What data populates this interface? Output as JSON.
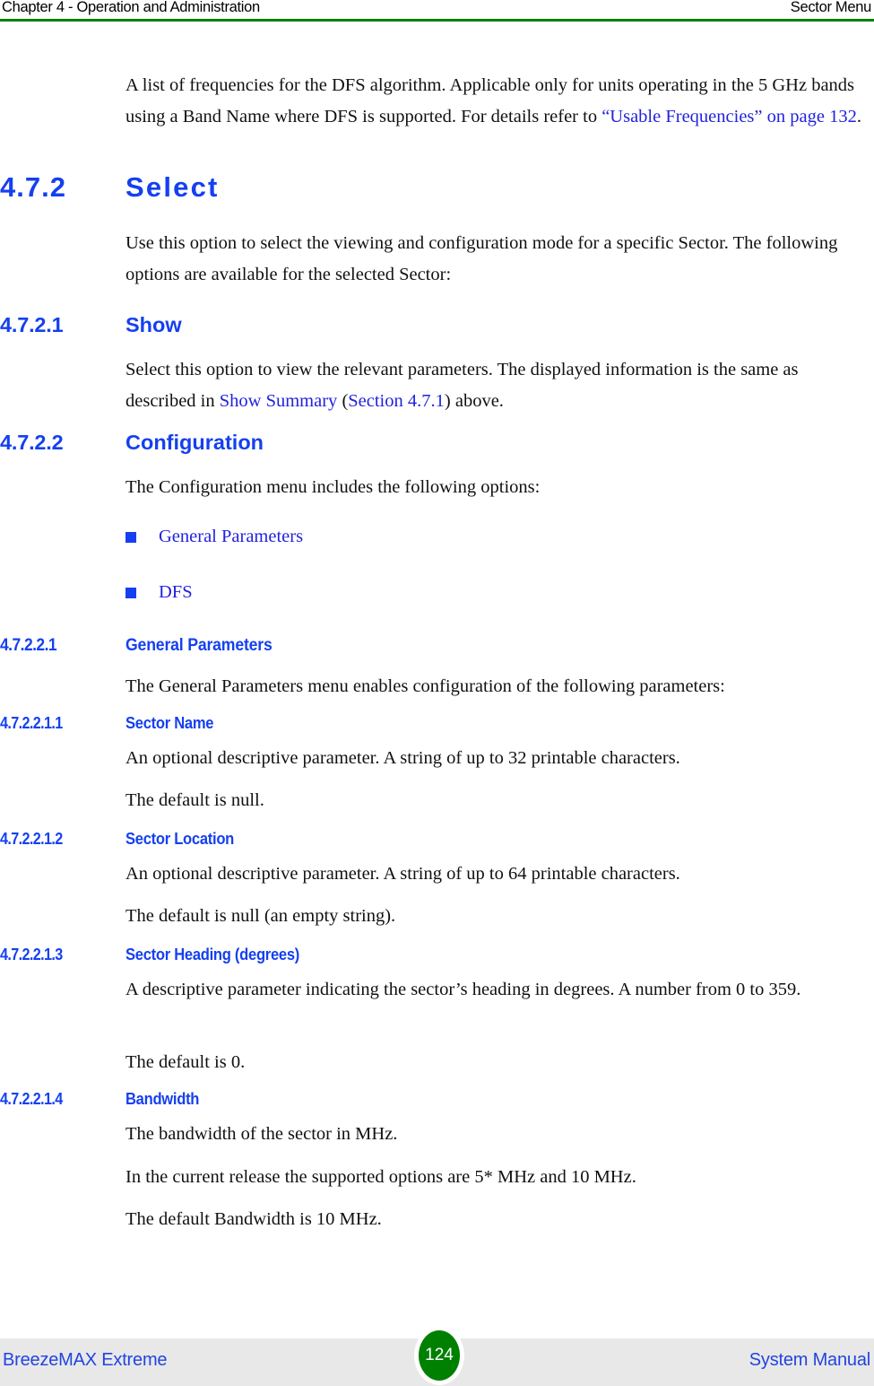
{
  "header": {
    "left": "Chapter 4 - Operation and Administration",
    "right": "Sector Menu",
    "rule_color": "#008000"
  },
  "intro": {
    "line1": "A list of frequencies for the DFS algorithm. Applicable only for units operating in",
    "line2": "the 5 GHz bands using a Band Name where DFS is supported. For details refer to",
    "link": "“Usable Frequencies” on page 132",
    "tail": "."
  },
  "section_select": {
    "number": "4.7.2",
    "title": "Select",
    "body": "Use this option to select the viewing and configuration mode for a specific Sector. The following options are available for the selected Sector:"
  },
  "section_show": {
    "number": "4.7.2.1",
    "title": "Show",
    "body_pre": "Select this option to view the relevant parameters. The displayed information is the same as described in ",
    "link1": "Show Summary",
    "mid": " (",
    "link2": "Section 4.7.1",
    "body_post": ") above."
  },
  "section_configuration": {
    "number": "4.7.2.2",
    "title": "Configuration",
    "body": "The Configuration menu includes the following options:",
    "options": [
      {
        "label": "General Parameters"
      },
      {
        "label": "DFS"
      }
    ]
  },
  "section_general_parameters": {
    "number": "4.7.2.2.1",
    "title": "General Parameters",
    "body": "The General Parameters menu enables configuration of the following parameters:"
  },
  "section_sector_name": {
    "number": "4.7.2.2.1.1",
    "title": "Sector Name",
    "body1": "An optional descriptive parameter. A string of up to 32 printable characters.",
    "body2": "The default is null."
  },
  "section_sector_location": {
    "number": "4.7.2.2.1.2",
    "title": "Sector Location",
    "body1": "An optional descriptive parameter. A string of up to 64 printable characters.",
    "body2": "The default is null (an empty string)."
  },
  "section_sector_heading": {
    "number": "4.7.2.2.1.3",
    "title": "Sector Heading (degrees)",
    "body1": "A descriptive parameter indicating the sector’s heading in degrees. A number from 0 to 359.",
    "body2": "The default is 0."
  },
  "section_bandwidth": {
    "number": "4.7.2.2.1.4",
    "title": "Bandwidth",
    "body1": "The bandwidth of the sector in MHz.",
    "body2": "In the current release the supported options are 5* MHz and 10 MHz.",
    "body3": "The default Bandwidth is 10 MHz."
  },
  "footer": {
    "left": "BreezeMAX Extreme",
    "page_number": "124",
    "right": "System Manual",
    "badge_color": "#008000",
    "band_color": "#e8e8e8"
  }
}
